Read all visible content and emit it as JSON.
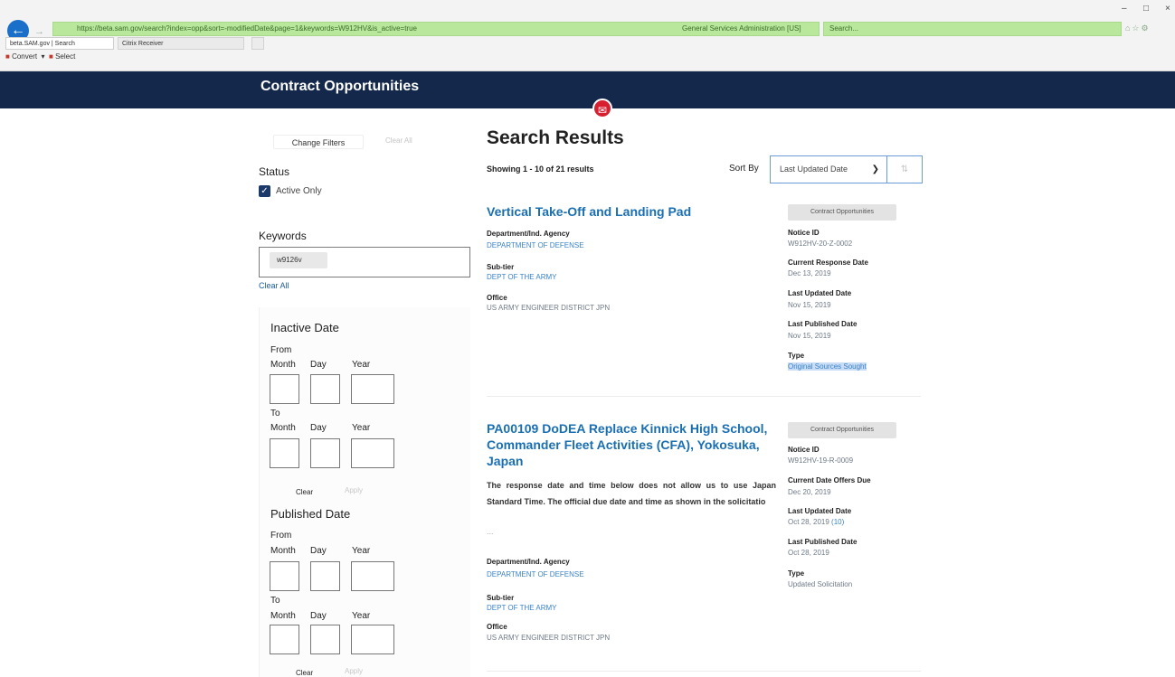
{
  "browser": {
    "url": "https://beta.sam.gov/search?index=opp&sort=-modifiedDate&page=1&keywords=W912HV&is_active=true",
    "tab_active": "beta.SAM.gov | Search",
    "tab_second": "Citrix Receiver",
    "identity": "General Services Administration [US]",
    "search_placeholder": "Search...",
    "fav_convert": "Convert",
    "fav_select": "Select"
  },
  "header": {
    "title": "Contract Opportunities"
  },
  "filters": {
    "change_filters": "Change Filters",
    "clear_all_top": "Clear All",
    "status_label": "Status",
    "active_only": "Active Only",
    "active_only_checked": true,
    "keywords_label": "Keywords",
    "keyword_chip": "w9126v",
    "keywords_clear": "Clear All",
    "inactive_date": {
      "title": "Inactive Date",
      "from": "From",
      "to": "To",
      "month": "Month",
      "day": "Day",
      "year": "Year",
      "clear": "Clear",
      "apply": "Apply"
    },
    "published_date": {
      "title": "Published Date",
      "from": "From",
      "to": "To",
      "month": "Month",
      "day": "Day",
      "year": "Year",
      "clear": "Clear",
      "apply": "Apply"
    }
  },
  "results": {
    "title": "Search Results",
    "showing": "Showing 1 - 10 of 21 results",
    "sort_by_label": "Sort By",
    "sort_value": "Last Updated Date",
    "items": [
      {
        "title": "Vertical Take-Off and Landing Pad",
        "chip": "Contract Opportunities",
        "dept_label": "Department/Ind. Agency",
        "dept_value": "DEPARTMENT OF DEFENSE",
        "subtier_label": "Sub-tier",
        "subtier_value": "DEPT OF THE ARMY",
        "office_label": "Office",
        "office_value": "US ARMY ENGINEER DISTRICT JPN",
        "notice_label": "Notice ID",
        "notice_value": "W912HV-20-Z-0002",
        "response_label": "Current Response Date",
        "response_value": "Dec 13, 2019",
        "updated_label": "Last Updated Date",
        "updated_value": "Nov 15, 2019",
        "published_label": "Last Published Date",
        "published_value": "Nov 15, 2019",
        "type_label": "Type",
        "type_value": "Original Sources Sought"
      },
      {
        "title": "PA00109 DoDEA Replace Kinnick High School, Commander Fleet Activities (CFA), Yokosuka, Japan",
        "chip": "Contract Opportunities",
        "description": "The response date and time below does not allow us to use Japan Standard Time. The official due date and time as shown in the solicitatio",
        "ellipsis": "...",
        "dept_label": "Department/Ind. Agency",
        "dept_value": "DEPARTMENT OF DEFENSE",
        "subtier_label": "Sub-tier",
        "subtier_value": "DEPT OF THE ARMY",
        "office_label": "Office",
        "office_value": "US ARMY ENGINEER DISTRICT JPN",
        "notice_label": "Notice ID",
        "notice_value": "W912HV-19-R-0009",
        "response_label": "Current Date Offers Due",
        "response_value": "Dec 20, 2019",
        "updated_label": "Last Updated Date",
        "updated_value": "Oct 28, 2019",
        "updated_count": "(10)",
        "published_label": "Last Published Date",
        "published_value": "Oct 28, 2019",
        "type_label": "Type",
        "type_value": "Updated Solicitation"
      }
    ]
  },
  "colors": {
    "header_bg": "#13284a",
    "link": "#1a6fb3",
    "feedback": "#d71f30"
  }
}
